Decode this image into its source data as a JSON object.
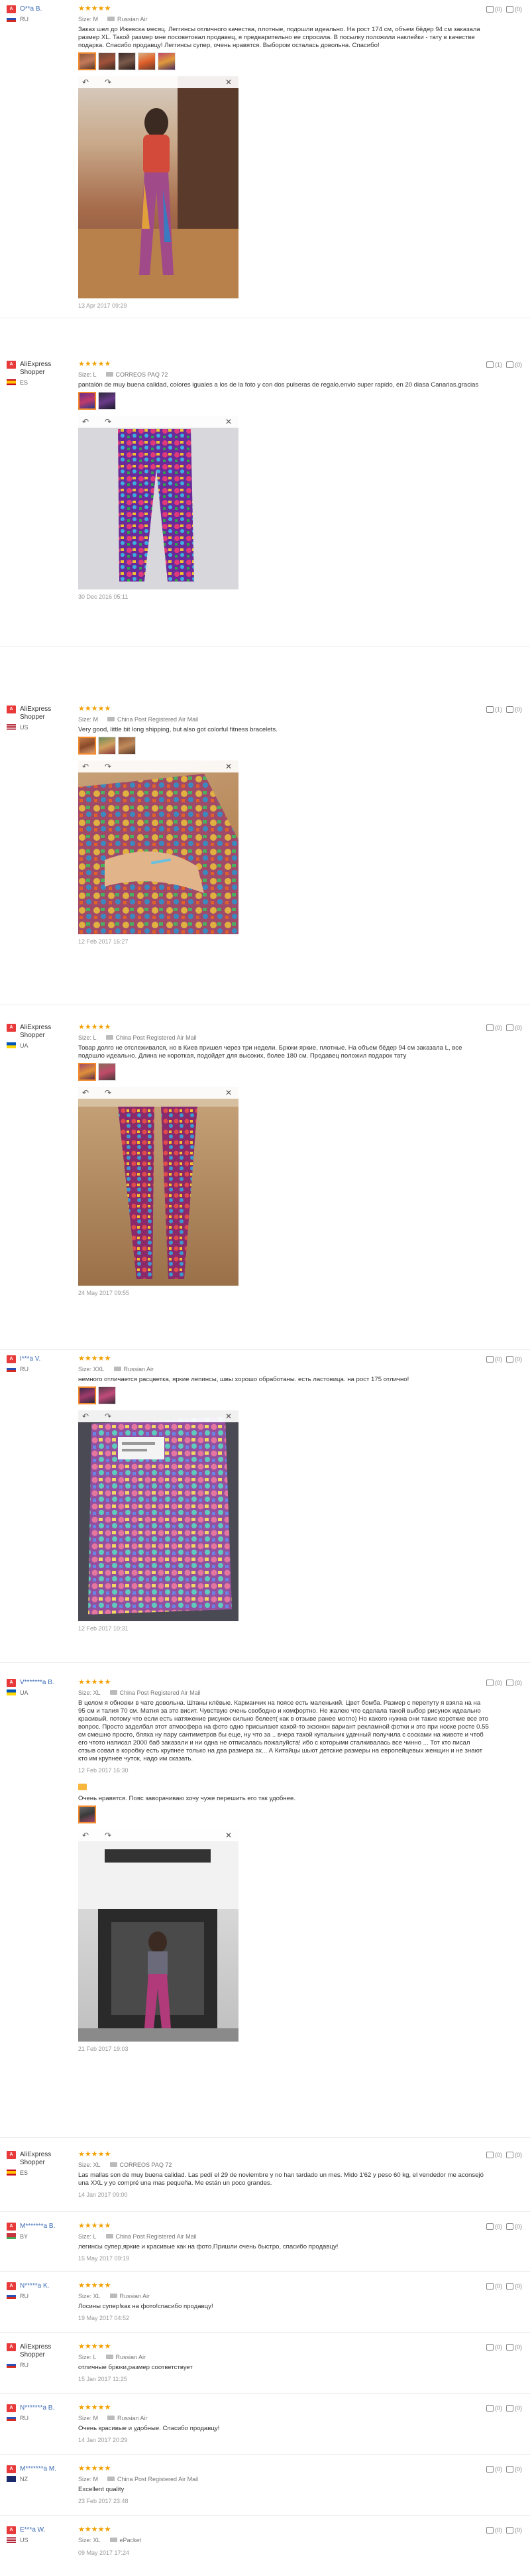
{
  "reviews": [
    {
      "avatar": "A",
      "name": "O**a B.",
      "country": "RU",
      "stars": "★★★★★",
      "size": "Size: M",
      "shipping": "Russian Air",
      "text": "Заказ шел до Ижевска месяц. Леггинсы отличного качества, плотные, подошли идеально. На рост 174 см, объем бёдер 94 см заказала размер XL. Такой размер мне посоветовал продавец, я предварительно ее спросила. В посылку положили наклейки - тату в качестве подарка. Спасибо продавцу! Леггинсы супер, очень нравятся. Выбором осталась довольна. Спасибо!",
      "date": "13 Apr 2017 09:29",
      "helpful": "(0)",
      "unhelpful": "(0)"
    },
    {
      "avatar": "A",
      "name": "AliExpress Shopper",
      "country": "ES",
      "stars": "★★★★★",
      "size": "Size: L",
      "shipping": "CORREOS PAQ 72",
      "text": "pantalón de muy buena calidad, colores iguales a los de la foto y con dos pulseras de regalo.envio super rapido, en 20 diasa Canarias.gracias",
      "date": "30 Dec 2016 05:11",
      "helpful": "(1)",
      "unhelpful": "(0)"
    },
    {
      "avatar": "A",
      "name": "AliExpress Shopper",
      "country": "US",
      "stars": "★★★★★",
      "size": "Size: M",
      "shipping": "China Post Registered Air Mail",
      "text": "Very good, little bit long shipping, but also got colorful fitness bracelets.",
      "date": "12 Feb 2017 16:27",
      "helpful": "(1)",
      "unhelpful": "(0)"
    },
    {
      "avatar": "A",
      "name": "AliExpress Shopper",
      "country": "UA",
      "stars": "★★★★★",
      "size": "Size: L",
      "shipping": "China Post Registered Air Mail",
      "text": "Товар долго не отслеживался, но в Киев пришел через три недели. Брюки яркие, плотные. На объем бёдер 94 см заказала L, все подошло идеально. Длина не короткая, подойдет для высоких, более 180 см. Продавец положил подарок тату",
      "date": "24 May 2017 09:55",
      "helpful": "(0)",
      "unhelpful": "(0)"
    },
    {
      "avatar": "A",
      "name": "I***a V.",
      "country": "RU",
      "stars": "★★★★★",
      "size": "Size: XXL",
      "shipping": "Russian Air",
      "text": "немного отличается расцветка, яркие лепинсы, швы хорошо обработаны. есть ластовица. на рост 175 отлично!",
      "date": "12 Feb 2017 10:31",
      "helpful": "(0)",
      "unhelpful": "(0)"
    },
    {
      "avatar": "A",
      "name": "V*******a B.",
      "country": "UA",
      "stars": "★★★★★",
      "size": "Size: XL",
      "shipping": "China Post Registered Air Mail",
      "text": "В целом я обновки в чате довольна. Штаны клёвые. Карманчик на поясе есть маленький. Цвет бомба. Размер с перепуту я взяла на на 95 см и талия 70 см. Матня за это висит. Чувствую очень свободно и комфортно. Не жалею что сделала такой выбор рисунок идеально красивый, потому что если есть натяжение рисунок сильно белеет( как в отзыве ранее могло) Но какого нужна они такие короткие все это вопрос. Просто заделбал этот атмосфера на фото одно присылают какой-то экзонон вариант рекламной фотки и это при носке росте 0.55 см смешно просто, бляха ну пару сантиметров бы еще, ну что за .. вчера такой купальник удачный получила с сосками на животе и чтоб его чтото написал 2000 баб заказали и ни одна не отписалась пожалуйста! ибо с которыми сталкивалась все чинно ... Тот кто писал отзыв совал в коробку есть крупнее только на два размера эх... А Китайцы шьют детские размеры на европейцевых женщин и не знают кто им крупнее чуток, надо им сказать.",
      "date": "12 Feb 2017 16:30",
      "additional": "Очень нравятся. Пояс заворачиваю хочу чуже перешить его так удобнее.",
      "additional_date": "21 Feb 2017 19:03",
      "helpful": "(0)",
      "unhelpful": "(0)"
    },
    {
      "avatar": "A",
      "name": "AliExpress Shopper",
      "country": "ES",
      "stars": "★★★★★",
      "size": "Size: XL",
      "shipping": "CORREOS PAQ 72",
      "text": "Las mallas son de muy buena calidad. Las pedí el 29 de noviembre y no han tardado un mes. Mido 1'62 y peso 60 kg, el vendedor me aconsejó una XXL y yo compré una mas pequeña. Me están un poco grandes.",
      "date": "14 Jan 2017 09:00",
      "helpful": "(0)",
      "unhelpful": "(0)"
    },
    {
      "avatar": "A",
      "name": "M*******a B.",
      "country": "BY",
      "stars": "★★★★★",
      "size": "Size: L",
      "shipping": "China Post Registered Air Mail",
      "text": "легинсы супер,яркие и красивые как на фото.Пришли очень быстро, спасибо продавцу!",
      "date": "15 May 2017 09:19",
      "helpful": "(0)",
      "unhelpful": "(0)"
    },
    {
      "avatar": "A",
      "name": "N*****a K.",
      "country": "RU",
      "stars": "★★★★★",
      "size": "Size: XL",
      "shipping": "Russian Air",
      "text": "Лосины супер!как на фото!спасибо продавцу!",
      "date": "19 May 2017 04:52",
      "helpful": "(0)",
      "unhelpful": "(0)"
    },
    {
      "avatar": "A",
      "name": "AliExpress Shopper",
      "country": "RU",
      "stars": "★★★★★",
      "size": "Size: L",
      "shipping": "Russian Air",
      "text": "отличные брюки,размер соответствует",
      "date": "15 Jan 2017 11:25",
      "helpful": "(0)",
      "unhelpful": "(0)"
    },
    {
      "avatar": "A",
      "name": "N*******a B.",
      "country": "RU",
      "stars": "★★★★★",
      "size": "Size: M",
      "shipping": "Russian Air",
      "text": "Очень красивые и удобные. Спасибо продавцу!",
      "date": "14 Jan 2017 20:29",
      "helpful": "(0)",
      "unhelpful": "(0)"
    },
    {
      "avatar": "A",
      "name": "M*******a M.",
      "country": "NZ",
      "stars": "★★★★★",
      "size": "Size: M",
      "shipping": "China Post Registered Air Mail",
      "text": "Excellent quality",
      "date": "23 Feb 2017 23:48",
      "helpful": "(0)",
      "unhelpful": "(0)"
    },
    {
      "avatar": "A",
      "name": "E***a W.",
      "country": "US",
      "stars": "★★★★★",
      "size": "Size: XL",
      "shipping": "ePacket",
      "text": "",
      "date": "09 May 2017 17:24",
      "helpful": "(0)",
      "unhelpful": "(0)"
    }
  ],
  "colors": {
    "star": "#f2a000",
    "avatar": "#e83a3a",
    "name_link": "#3a6bb5",
    "selected_thumb": "#f48a2c"
  },
  "icons": {
    "rotate_left": "rotate-left-icon",
    "rotate_right": "rotate-right-icon",
    "close": "close-icon",
    "helpful": "thumbs-up-icon",
    "unhelpful": "thumbs-down-icon",
    "shipping": "truck-icon"
  }
}
